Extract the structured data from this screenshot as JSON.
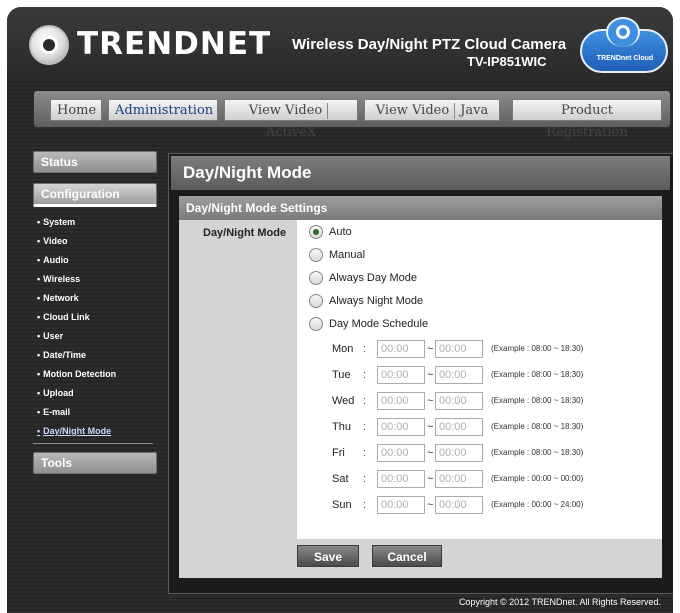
{
  "brand": {
    "logo_text": "TRENDNET",
    "product_title": "Wireless Day/Night PTZ Cloud Camera",
    "model": "TV-IP851WIC",
    "cloud_label": "TRENDnet Cloud"
  },
  "nav": {
    "home": "Home",
    "administration": "Administration",
    "view_video_activex_a": "View Video",
    "view_video_activex_b": "ActiveX",
    "view_video_java_a": "View Video",
    "view_video_java_b": "Java",
    "product_registration": "Product Registration"
  },
  "sidebar": {
    "status": "Status",
    "configuration": "Configuration",
    "items": [
      "System",
      "Video",
      "Audio",
      "Wireless",
      "Network",
      "Cloud Link",
      "User",
      "Date/Time",
      "Motion Detection",
      "Upload",
      "E-mail",
      "Day/Night Mode"
    ],
    "current_index": 11,
    "tools": "Tools"
  },
  "main": {
    "title": "Day/Night Mode",
    "section": "Day/Night Mode Settings",
    "field_label": "Day/Night Mode",
    "options": [
      "Auto",
      "Manual",
      "Always Day Mode",
      "Always Night Mode",
      "Day Mode Schedule"
    ],
    "selected_option": "Auto",
    "schedule": [
      {
        "day": "Mon",
        "start": "00:00",
        "end": "00:00",
        "example": "(Example : 08:00 ~ 18:30)"
      },
      {
        "day": "Tue",
        "start": "00:00",
        "end": "00:00",
        "example": "(Example : 08:00 ~ 18:30)"
      },
      {
        "day": "Wed",
        "start": "00:00",
        "end": "00:00",
        "example": "(Example : 08:00 ~ 18:30)"
      },
      {
        "day": "Thu",
        "start": "00:00",
        "end": "00:00",
        "example": "(Example : 08:00 ~ 18:30)"
      },
      {
        "day": "Fri",
        "start": "00:00",
        "end": "00:00",
        "example": "(Example : 08:00 ~ 18:30)"
      },
      {
        "day": "Sat",
        "start": "00:00",
        "end": "00:00",
        "example": "(Example : 00:00 ~ 00:00)"
      },
      {
        "day": "Sun",
        "start": "00:00",
        "end": "00:00",
        "example": "(Example : 00:00 ~ 24:00)"
      }
    ],
    "separator": "~",
    "colon": ":",
    "save_label": "Save",
    "cancel_label": "Cancel"
  },
  "footer": {
    "copyright": "Copyright © 2012 TRENDnet.  All Rights Reserved."
  }
}
